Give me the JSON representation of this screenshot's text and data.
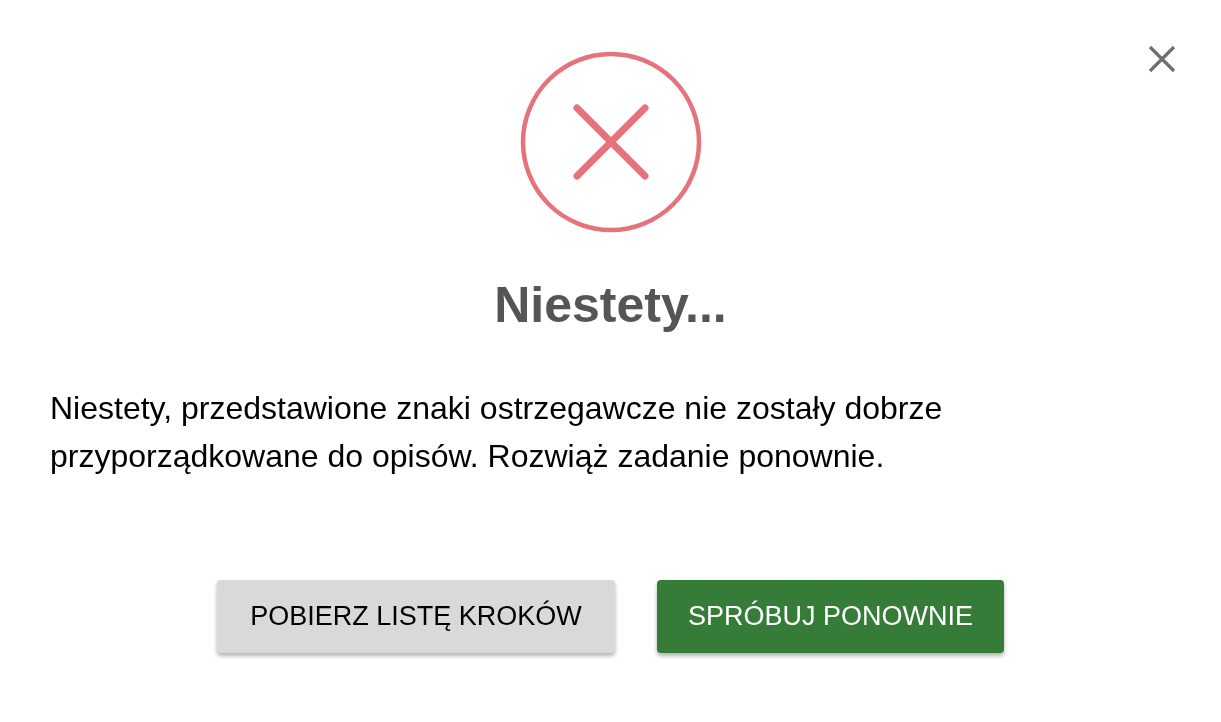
{
  "title": "Niestety...",
  "message": "Niestety, przedstawione znaki ostrzegawcze nie zostały dobrze przyporządkowane do opisów. Rozwiąż zadanie ponownie.",
  "buttons": [
    {
      "label": "POBIERZ LISTĘ KROKÓW",
      "kind": "secondary"
    },
    {
      "label": "SPRÓBUJ PONOWNIE",
      "kind": "primary"
    }
  ]
}
